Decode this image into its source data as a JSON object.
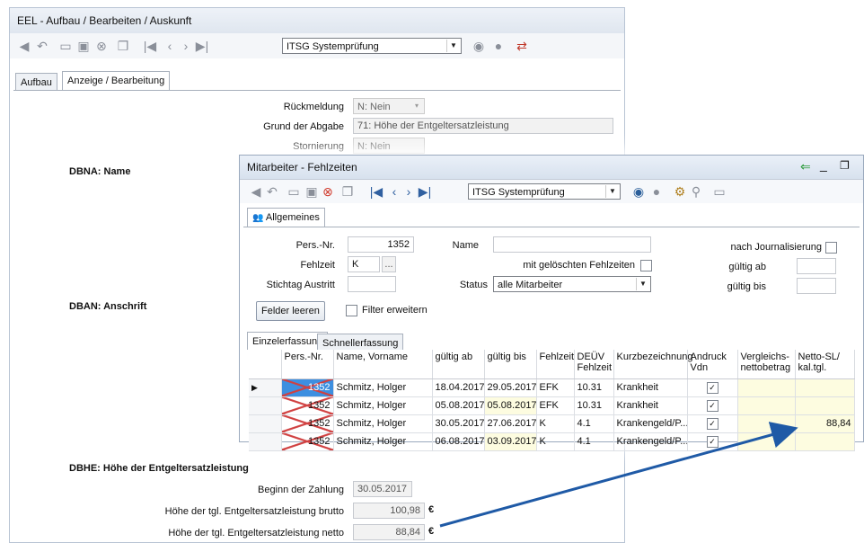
{
  "back": {
    "title": "EEL - Aufbau / Bearbeiten / Auskunft",
    "toolbar_combo": "ITSG Systemprüfung",
    "tabs": [
      "Aufbau",
      "Anzeige / Bearbeitung"
    ],
    "rueckmeldung_label": "Rückmeldung",
    "rueckmeldung_value": "N: Nein",
    "grund_label": "Grund der Abgabe",
    "grund_value": "71: Höhe der Entgeltersatzleistung",
    "storno_label": "Stornierung",
    "storno_value": "N: Nein",
    "section_name": "DBNA: Name",
    "section_anschrift": "DBAN: Anschrift",
    "section_hoehe": "DBHE: Höhe der Entgeltersatzleistung",
    "beginn_label": "Beginn der Zahlung",
    "beginn_value": "30.05.2017",
    "brutto_label": "Höhe der tgl. Entgeltersatzleistung brutto",
    "brutto_value": "100,98",
    "netto_label": "Höhe der tgl. Entgeltersatzleistung netto",
    "netto_value": "88,84",
    "euro": "€"
  },
  "front": {
    "title": "Mitarbeiter - Fehlzeiten",
    "toolbar_combo": "ITSG Systemprüfung",
    "tab_allgemeines": "Allgemeines",
    "pers_nr_label": "Pers.-Nr.",
    "pers_nr_value": "1352",
    "name_label": "Name",
    "fehlzeit_label": "Fehlzeit",
    "fehlzeit_value": "K",
    "fehlzeit_btn": "...",
    "stichtag_label": "Stichtag Austritt",
    "status_label": "Status",
    "status_value": "alle Mitarbeiter",
    "geloeschte_label": "mit gelöschten Fehlzeiten",
    "journal_label": "nach Journalisierung",
    "gueltig_ab_label": "gültig ab",
    "gueltig_bis_label": "gültig bis",
    "felder_leeren": "Felder leeren",
    "filter_erweitern": "Filter erweitern",
    "subtabs": [
      "Einzelerfassung",
      "Schnellerfassung"
    ],
    "columns": [
      "Pers.-Nr.",
      "Name, Vorname",
      "gültig ab",
      "gültig bis",
      "Fehlzeit",
      "DEÜV Fehlzeit",
      "Kurzbezeichnung",
      "Andruck Vdn",
      "Vergleichs-nettobetrag",
      "Netto-SL/ kal.tgl."
    ],
    "rows": [
      {
        "nr": "1352",
        "name": "Schmitz, Holger",
        "ab": "18.04.2017",
        "bis": "29.05.2017",
        "fz": "EFK",
        "deuev": "10.31",
        "kurz": "Krankheit",
        "andruck": "✓",
        "vgl": "",
        "netto": ""
      },
      {
        "nr": "1352",
        "name": "Schmitz, Holger",
        "ab": "05.08.2017",
        "bis": "05.08.2017",
        "fz": "EFK",
        "deuev": "10.31",
        "kurz": "Krankheit",
        "andruck": "✓",
        "vgl": "",
        "netto": ""
      },
      {
        "nr": "1352",
        "name": "Schmitz, Holger",
        "ab": "30.05.2017",
        "bis": "27.06.2017",
        "fz": "K",
        "deuev": "4.1",
        "kurz": "Krankengeld/P...",
        "andruck": "✓",
        "vgl": "",
        "netto": "88,84"
      },
      {
        "nr": "1352",
        "name": "Schmitz, Holger",
        "ab": "06.08.2017",
        "bis": "03.09.2017",
        "fz": "K",
        "deuev": "4.1",
        "kurz": "Krankengeld/P...",
        "andruck": "✓",
        "vgl": "",
        "netto": ""
      }
    ]
  },
  "colors": {
    "arrow": "#1f5aa6",
    "selection": "#3d8fe0",
    "highlight": "#fdfce0"
  }
}
